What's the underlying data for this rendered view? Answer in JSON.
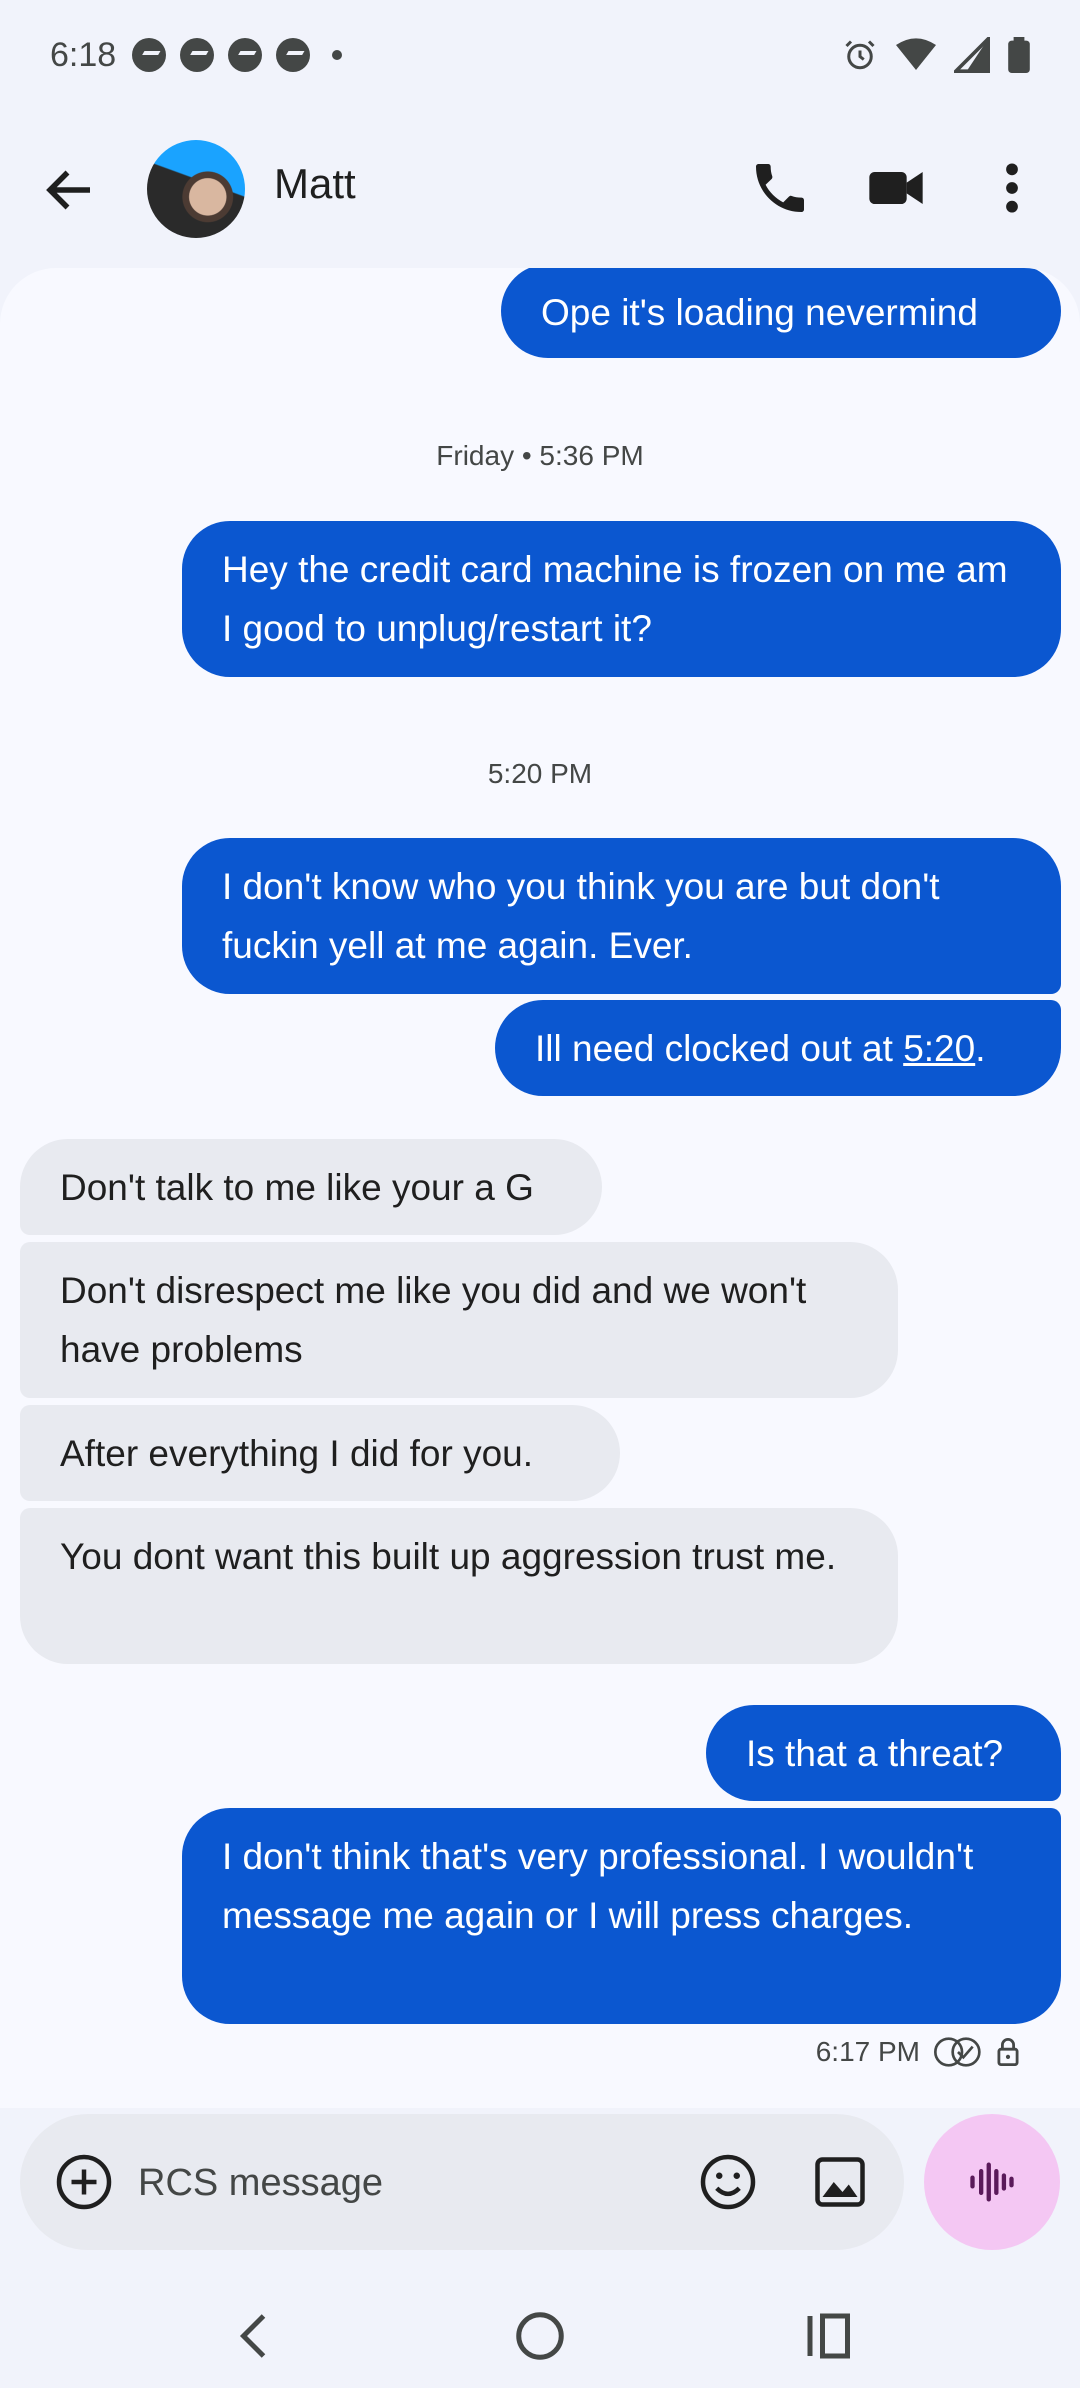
{
  "status_bar": {
    "time": "6:18"
  },
  "header": {
    "contact_name": "Matt"
  },
  "messages": [
    {
      "direction": "out",
      "text": "Ope it's loading nevermind"
    },
    {
      "type": "timestamp",
      "text": "Friday • 5:36 PM"
    },
    {
      "direction": "out",
      "text": "Hey the credit card machine is frozen on me am I good to unplug/restart it?"
    },
    {
      "type": "timestamp",
      "text": "5:20 PM"
    },
    {
      "direction": "out",
      "text": "I don't know who you think you are but don't fuckin yell at me again. Ever."
    },
    {
      "direction": "out",
      "text_prefix": "Ill need clocked out at ",
      "link": "5:20",
      "text_suffix": "."
    },
    {
      "direction": "in",
      "text": "Don't talk to me like your a G"
    },
    {
      "direction": "in",
      "text": "Don't disrespect me like you did and we won't have problems"
    },
    {
      "direction": "in",
      "text": "After everything I did for you."
    },
    {
      "direction": "in",
      "text": "You dont want this built up aggression trust me."
    },
    {
      "direction": "out",
      "text": "Is that a threat?"
    },
    {
      "direction": "out",
      "text": "I don't think that's very professional. I wouldn't message me again or I will press charges."
    }
  ],
  "last_message_meta": {
    "time": "6:17 PM",
    "status_icon": "read-double-check-icon",
    "encryption_icon": "lock-icon"
  },
  "composer": {
    "placeholder": "RCS message"
  },
  "colors": {
    "outgoing_bubble": "#0b57d0",
    "incoming_bubble": "#e8eaf0",
    "voice_button": "#f4c7f3",
    "background": "#f1f3fb"
  }
}
